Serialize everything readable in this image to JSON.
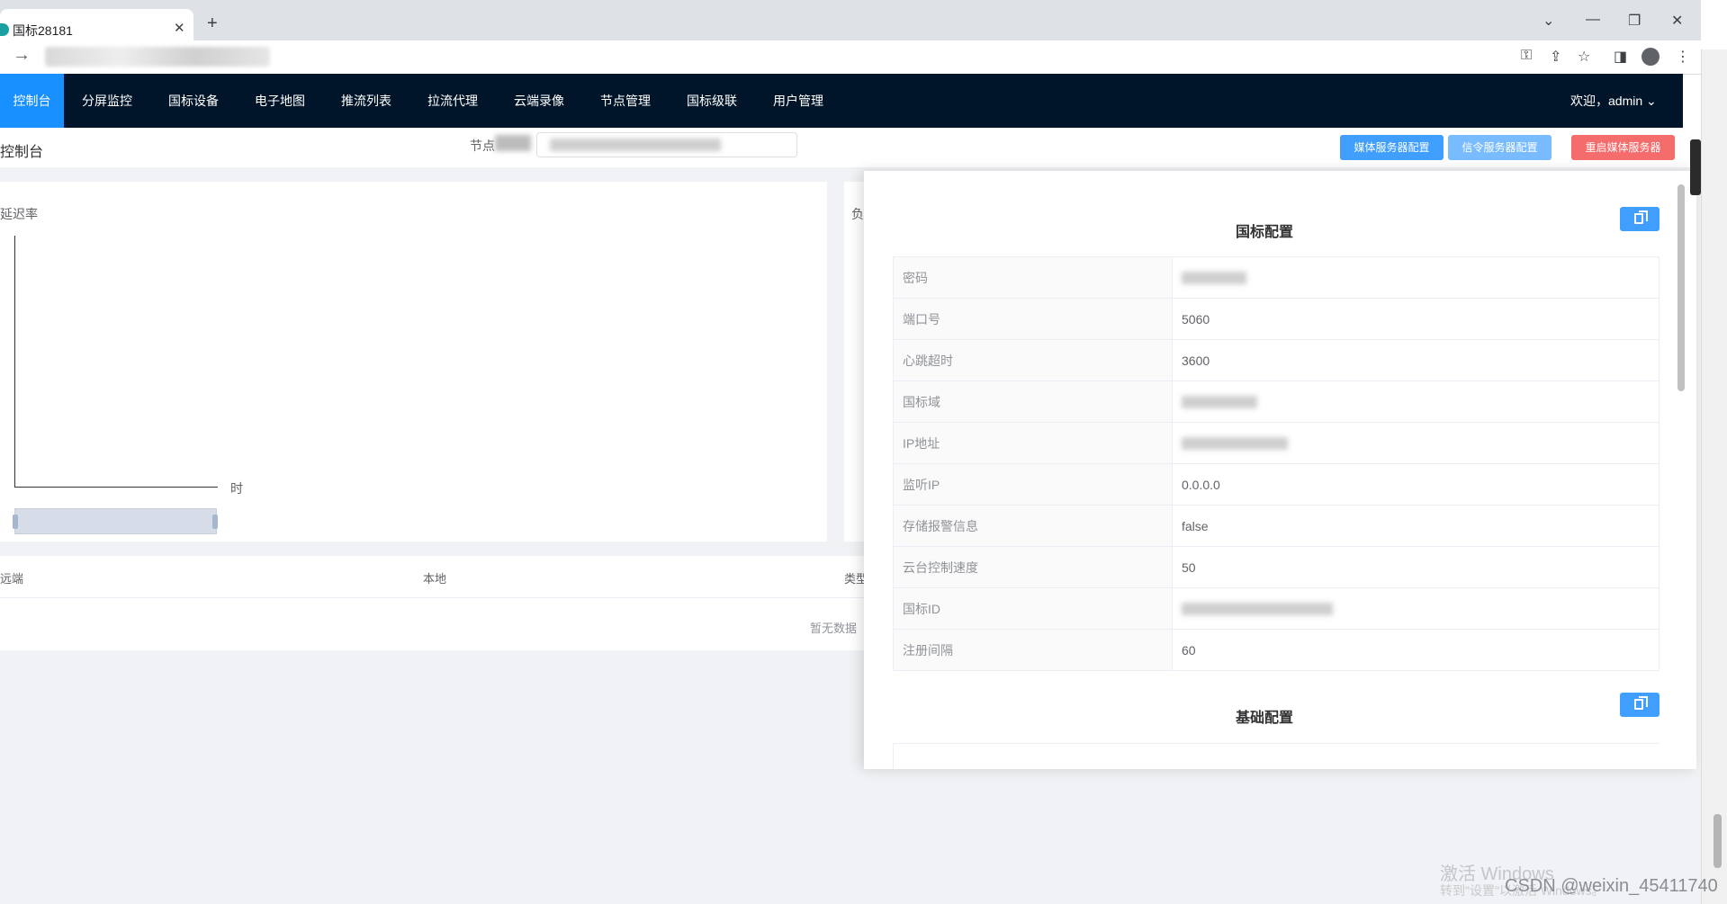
{
  "browser": {
    "tab_title": "国标28181",
    "tab_close": "✕",
    "new_tab": "+",
    "win_min": "—",
    "win_max": "❐",
    "win_close": "✕",
    "win_collapse": "⌄"
  },
  "nav": {
    "items": [
      "控制台",
      "分屏监控",
      "国标设备",
      "电子地图",
      "推流列表",
      "拉流代理",
      "云端录像",
      "节点管理",
      "国标级联",
      "用户管理"
    ],
    "user": "欢迎，admin ⌄"
  },
  "header": {
    "title": "控制台",
    "node_label": "节点",
    "buttons": {
      "media_config": "媒体服务器配置",
      "signal_config": "信令服务器配置",
      "restart_media": "重启媒体服务器"
    },
    "colors": {
      "media": "#409eff",
      "signal": "#79bbff",
      "restart": "#f56c6c"
    }
  },
  "chart": {
    "label": "延迟率",
    "xlabel": "时",
    "right_label": "负"
  },
  "table": {
    "headers": [
      "远端",
      "本地",
      "类型"
    ],
    "empty": "暂无数据"
  },
  "drawer": {
    "section1": {
      "title": "国标配置",
      "rows": [
        {
          "label": "密码",
          "value": ""
        },
        {
          "label": "端口号",
          "value": "5060"
        },
        {
          "label": "心跳超时",
          "value": "3600"
        },
        {
          "label": "国标域",
          "value": ""
        },
        {
          "label": "IP地址",
          "value": ""
        },
        {
          "label": "监听IP",
          "value": "0.0.0.0"
        },
        {
          "label": "存储报警信息",
          "value": "false"
        },
        {
          "label": "云台控制速度",
          "value": "50"
        },
        {
          "label": "国标ID",
          "value": ""
        },
        {
          "label": "注册间隔",
          "value": "60"
        }
      ]
    },
    "section2": {
      "title": "基础配置"
    }
  },
  "watermark": {
    "activate": "激活 Windows",
    "activate_hint": "转到\"设置\"以激活 Windows。",
    "csdn": "CSDN @weixin_45411740"
  }
}
